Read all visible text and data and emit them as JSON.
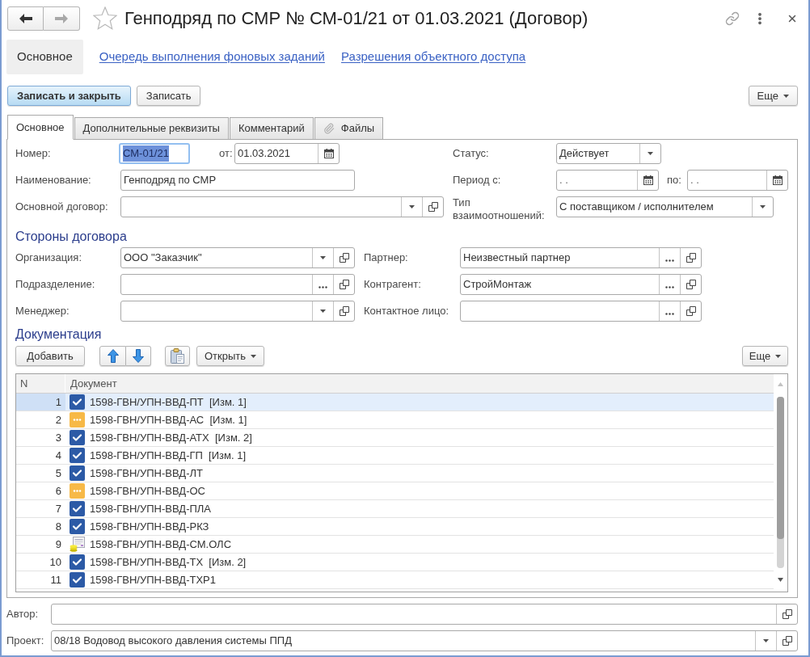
{
  "window": {
    "title": "Генподряд по СМР № СМ-01/21 от 01.03.2021 (Договор)",
    "favorite": false
  },
  "history_buttons": [
    {
      "kind": "back",
      "disabled": false
    },
    {
      "kind": "forward",
      "disabled": true
    }
  ],
  "section_nav": [
    {
      "label": "Основное",
      "selected": true
    },
    {
      "label": "Очередь выполнения фоновых заданий",
      "selected": false
    },
    {
      "label": "Разрешения объектного доступа",
      "selected": false
    }
  ],
  "command_bar": {
    "buttons": [
      {
        "label": "Записать и закрыть",
        "kind": "primary"
      },
      {
        "label": "Записать",
        "kind": "normal"
      }
    ],
    "more": "Еще"
  },
  "tabs": [
    {
      "label": "Основное",
      "selected": true,
      "kind": "plain"
    },
    {
      "label": "Дополнительные реквизиты",
      "selected": false,
      "kind": "plain"
    },
    {
      "label": "Комментарий",
      "selected": false,
      "kind": "plain"
    },
    {
      "label": "Файлы",
      "selected": false,
      "kind": "attachments"
    }
  ],
  "main": {
    "number": {
      "label": "Номер:",
      "value": "СМ-01/21",
      "focused": true
    },
    "date": {
      "label": "от:",
      "value": "01.03.2021"
    },
    "status": {
      "label": "Статус:",
      "value": "Действует"
    },
    "name": {
      "label": "Наименование:",
      "value": "Генподряд по СМР"
    },
    "period_from": {
      "label": "Период с:",
      "placeholder": ". ."
    },
    "period_to": {
      "label": "по:",
      "placeholder": ". ."
    },
    "base_contract": {
      "label": "Основной договор:"
    },
    "relationship_type": {
      "label": "Тип взаимоотношений:",
      "value": "С поставщиком / исполнителем"
    }
  },
  "parties": {
    "title": "Стороны договора",
    "rows": [
      {
        "left": {
          "label": "Организация:",
          "value": "ООО \"Заказчик\"",
          "kind": "dropdown"
        },
        "right": {
          "label": "Партнер:",
          "value": "Неизвестный партнер",
          "kind": "choice"
        }
      },
      {
        "left": {
          "label": "Подразделение:",
          "kind": "choice"
        },
        "right": {
          "label": "Контрагент:",
          "value": "СтройМонтаж",
          "kind": "choice"
        }
      },
      {
        "left": {
          "label": "Менеджер:",
          "kind": "dropdown"
        },
        "right": {
          "label": "Контактное лицо:",
          "kind": "choice"
        }
      }
    ]
  },
  "documentation": {
    "title": "Документация",
    "add_button": "Добавить",
    "open_button": "Открыть",
    "more_button": "Еще",
    "table": {
      "columns": [
        "N",
        "Документ"
      ],
      "rows": [
        {
          "n": "1",
          "document": "1598-ГВН/УПН-ВВД-ПТ  [Изм. 1]",
          "kind": "approved",
          "selected": true
        },
        {
          "n": "2",
          "document": "1598-ГВН/УПН-ВВД-АС  [Изм. 1]",
          "kind": "in_progress",
          "selected": false
        },
        {
          "n": "3",
          "document": "1598-ГВН/УПН-ВВД-АТХ  [Изм. 2]",
          "kind": "approved",
          "selected": false
        },
        {
          "n": "4",
          "document": "1598-ГВН/УПН-ВВД-ГП  [Изм. 1]",
          "kind": "approved",
          "selected": false
        },
        {
          "n": "5",
          "document": "1598-ГВН/УПН-ВВД-ЛТ",
          "kind": "approved",
          "selected": false
        },
        {
          "n": "6",
          "document": "1598-ГВН/УПН-ВВД-ОС",
          "kind": "in_progress",
          "selected": false
        },
        {
          "n": "7",
          "document": "1598-ГВН/УПН-ВВД-ПЛА",
          "kind": "approved",
          "selected": false
        },
        {
          "n": "8",
          "document": "1598-ГВН/УПН-ВВД-РКЗ",
          "kind": "approved",
          "selected": false
        },
        {
          "n": "9",
          "document": "1598-ГВН/УПН-ВВД-СМ.ОЛС",
          "kind": "estimate",
          "selected": false
        },
        {
          "n": "10",
          "document": "1598-ГВН/УПН-ВВД-ТХ  [Изм. 2]",
          "kind": "approved",
          "selected": false
        },
        {
          "n": "11",
          "document": "1598-ГВН/УПН-ВВД-ТХР1",
          "kind": "approved",
          "selected": false
        }
      ]
    }
  },
  "footer": {
    "author": {
      "label": "Автор:"
    },
    "project": {
      "label": "Проект:",
      "value": "08/18 Водовод высокого давления системы ППД"
    }
  }
}
